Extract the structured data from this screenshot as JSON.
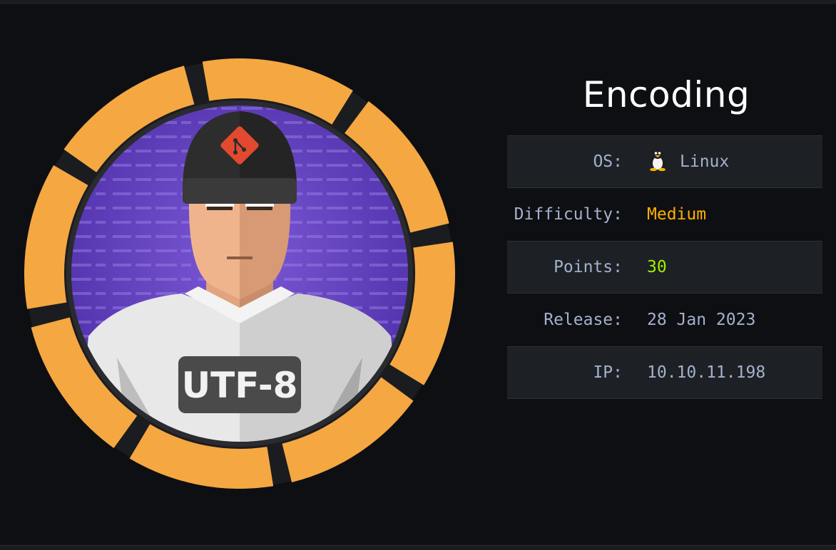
{
  "machine": {
    "name": "Encoding",
    "avatar_badge": "UTF-8",
    "avatar_background_text": "the coded chars these",
    "colors": {
      "ring": "#f5a742",
      "background": "#0e0f12",
      "accent_medium": "#ffaf00",
      "accent_points": "#9fef00"
    }
  },
  "info": {
    "os_label": "OS:",
    "os_icon": "linux-penguin-icon",
    "os_value": "Linux",
    "difficulty_label": "Difficulty:",
    "difficulty_value": "Medium",
    "points_label": "Points:",
    "points_value": "30",
    "release_label": "Release:",
    "release_value": "28 Jan 2023",
    "ip_label": "IP:",
    "ip_value": "10.10.11.198"
  }
}
